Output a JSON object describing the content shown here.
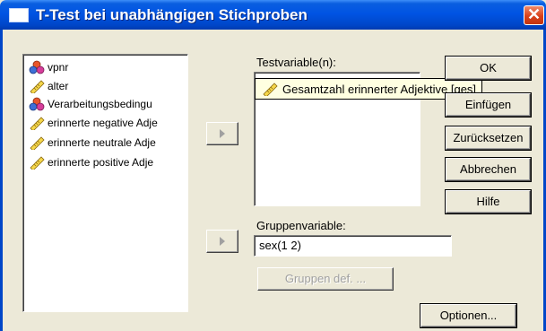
{
  "window": {
    "title": "T-Test bei unabhängigen Stichproben",
    "close_glyph": "✕"
  },
  "source_list": {
    "items": [
      {
        "label": "vpnr",
        "icon": "nominal-variable-icon"
      },
      {
        "label": "alter",
        "icon": "scale-variable-icon"
      },
      {
        "label": "Verarbeitungsbedingu",
        "icon": "nominal-variable-icon"
      },
      {
        "label": "erinnerte negative Adje",
        "icon": "scale-variable-icon"
      },
      {
        "label": "erinnerte neutrale Adje",
        "icon": "scale-variable-icon"
      },
      {
        "label": "erinnerte positive Adje",
        "icon": "scale-variable-icon"
      }
    ]
  },
  "test_variables": {
    "label": "Testvariable(n):",
    "items": [
      {
        "label": "Gesamtzahl erinnerter Adjektive [ges]",
        "icon": "scale-variable-icon"
      }
    ]
  },
  "grouping": {
    "label": "Gruppenvariable:",
    "value": "sex(1 2)",
    "define_button": "Gruppen def. ..."
  },
  "buttons": {
    "ok": "OK",
    "paste": "Einfügen",
    "reset": "Zurücksetzen",
    "cancel": "Abbrechen",
    "help": "Hilfe",
    "options": "Optionen..."
  },
  "colors": {
    "titlebar": "#0054e3",
    "dialog_bg": "#ece9d8",
    "tooltip_bg": "#ffffe1"
  }
}
